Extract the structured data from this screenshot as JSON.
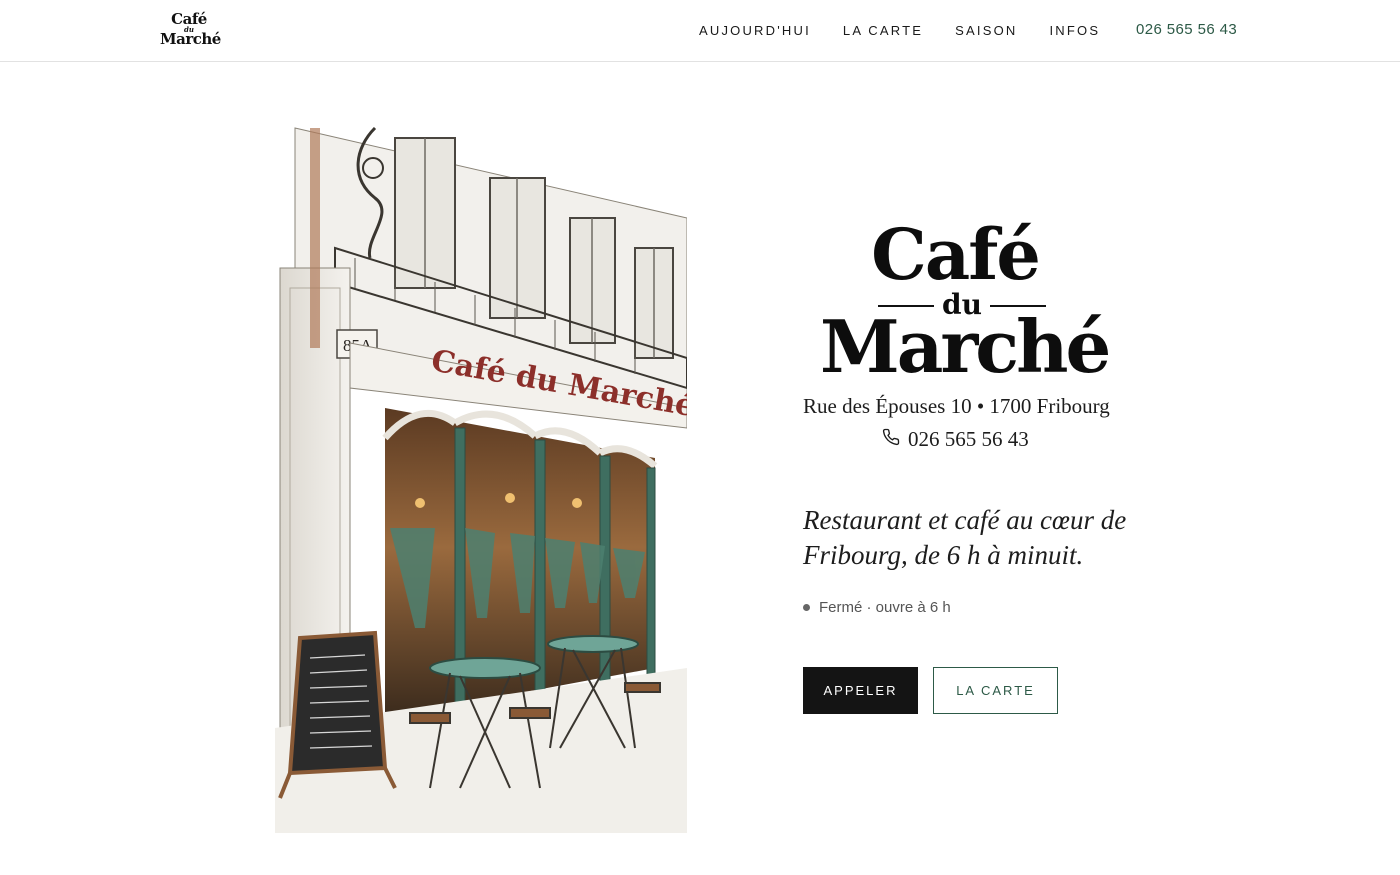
{
  "header": {
    "brand_line1": "Café",
    "brand_line2": "du",
    "brand_line3": "Marché",
    "nav": [
      {
        "label": "AUJOURD'HUI"
      },
      {
        "label": "LA CARTE"
      },
      {
        "label": "SAISON"
      },
      {
        "label": "INFOS"
      }
    ],
    "phone": "026 565 56 43"
  },
  "hero": {
    "illustration": {
      "sign_text": "Café du Marché",
      "house_number": "85A"
    },
    "logo": {
      "line1": "Café",
      "line2": "du",
      "line3": "Marché"
    },
    "address": "Rue des Épouses 10 • 1700 Fribourg",
    "phone": "026 565 56 43",
    "phone_icon": "phone-icon",
    "tagline": "Restaurant et café au cœur de Fribourg, de 6 h à minuit.",
    "status": "Fermé · ouvre à 6 h",
    "buttons": {
      "call": "APPELER",
      "menu": "LA CARTE"
    }
  },
  "colors": {
    "accent_green": "#2d5a47",
    "button_dark": "#141414",
    "sign_red": "#8c2f2a",
    "curtain_green": "#3f6e60"
  }
}
